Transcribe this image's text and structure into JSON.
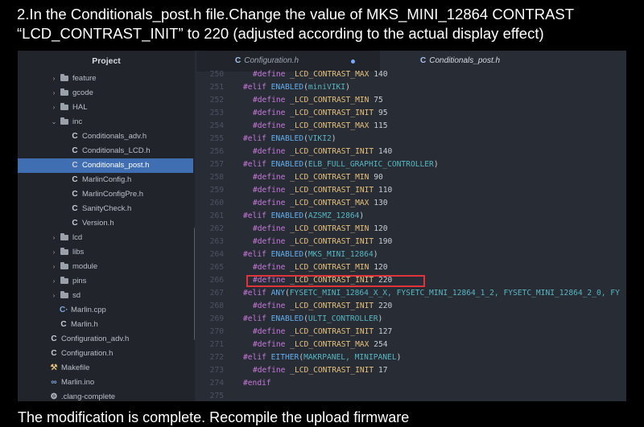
{
  "caption_top": [
    "2.In the Conditionals_post.h file.Change the value of MKS_MINI_12864 CONTRAST",
    "“LCD_CONTRAST_INIT” to 220 (adjusted according to the actual display effect)"
  ],
  "caption_bottom": "The modification is complete. Recompile the upload firmware",
  "sidebar": {
    "title": "Project",
    "items": [
      {
        "label": "feature",
        "type": "folder",
        "expanded": false
      },
      {
        "label": "gcode",
        "type": "folder",
        "expanded": false
      },
      {
        "label": "HAL",
        "type": "folder",
        "expanded": false
      },
      {
        "label": "inc",
        "type": "folder",
        "expanded": true
      },
      {
        "label": "Conditionals_adv.h",
        "type": "c-file"
      },
      {
        "label": "Conditionals_LCD.h",
        "type": "c-file"
      },
      {
        "label": "Conditionals_post.h",
        "type": "c-file",
        "selected": true
      },
      {
        "label": "MarlinConfig.h",
        "type": "c-file"
      },
      {
        "label": "MarlinConfigPre.h",
        "type": "c-file"
      },
      {
        "label": "SanityCheck.h",
        "type": "c-file"
      },
      {
        "label": "Version.h",
        "type": "c-file"
      },
      {
        "label": "lcd",
        "type": "folder",
        "expanded": false
      },
      {
        "label": "libs",
        "type": "folder",
        "expanded": false
      },
      {
        "label": "module",
        "type": "folder",
        "expanded": false
      },
      {
        "label": "pins",
        "type": "folder",
        "expanded": false
      },
      {
        "label": "sd",
        "type": "folder",
        "expanded": false
      },
      {
        "label": "Marlin.cpp",
        "type": "cpp-file"
      },
      {
        "label": "Marlin.h",
        "type": "c-file"
      },
      {
        "label": "Configuration_adv.h",
        "type": "c-file"
      },
      {
        "label": "Configuration.h",
        "type": "c-file"
      },
      {
        "label": "Makefile",
        "type": "make-file"
      },
      {
        "label": "Marlin.ino",
        "type": "ino-file"
      },
      {
        "label": ".clang-complete",
        "type": "gear-file"
      }
    ]
  },
  "tabs": [
    {
      "label": "Configuration.h",
      "modified": true
    },
    {
      "label": "Conditionals_post.h",
      "active": true
    }
  ],
  "code_lines": [
    {
      "n": "250",
      "indent": 1,
      "kind": "define",
      "name": "_LCD_CONTRAST_MAX",
      "value": "140"
    },
    {
      "n": "251",
      "indent": 0,
      "kind": "elif",
      "fn": "ENABLED",
      "arg": "miniVIKI"
    },
    {
      "n": "252",
      "indent": 1,
      "kind": "define",
      "name": "_LCD_CONTRAST_MIN",
      "value": "75"
    },
    {
      "n": "253",
      "indent": 1,
      "kind": "define",
      "name": "_LCD_CONTRAST_INIT",
      "value": "95"
    },
    {
      "n": "254",
      "indent": 1,
      "kind": "define",
      "name": "_LCD_CONTRAST_MAX",
      "value": "115"
    },
    {
      "n": "255",
      "indent": 0,
      "kind": "elif",
      "fn": "ENABLED",
      "arg": "VIKI2"
    },
    {
      "n": "256",
      "indent": 1,
      "kind": "define",
      "name": "_LCD_CONTRAST_INIT",
      "value": "140"
    },
    {
      "n": "257",
      "indent": 0,
      "kind": "elif",
      "fn": "ENABLED",
      "arg": "ELB_FULL_GRAPHIC_CONTROLLER"
    },
    {
      "n": "258",
      "indent": 1,
      "kind": "define",
      "name": "_LCD_CONTRAST_MIN",
      "value": "90"
    },
    {
      "n": "259",
      "indent": 1,
      "kind": "define",
      "name": "_LCD_CONTRAST_INIT",
      "value": "110"
    },
    {
      "n": "260",
      "indent": 1,
      "kind": "define",
      "name": "_LCD_CONTRAST_MAX",
      "value": "130"
    },
    {
      "n": "261",
      "indent": 0,
      "kind": "elif",
      "fn": "ENABLED",
      "arg": "AZSMZ_12864"
    },
    {
      "n": "262",
      "indent": 1,
      "kind": "define",
      "name": "_LCD_CONTRAST_MIN",
      "value": "120"
    },
    {
      "n": "263",
      "indent": 1,
      "kind": "define",
      "name": "_LCD_CONTRAST_INIT",
      "value": "190"
    },
    {
      "n": "264",
      "indent": 0,
      "kind": "elif",
      "fn": "ENABLED",
      "arg": "MKS_MINI_12864"
    },
    {
      "n": "265",
      "indent": 1,
      "kind": "define",
      "name": "_LCD_CONTRAST_MIN",
      "value": "120"
    },
    {
      "n": "266",
      "indent": 1,
      "kind": "define",
      "name": "_LCD_CONTRAST_INIT",
      "value": "220",
      "highlight": true
    },
    {
      "n": "267",
      "indent": 0,
      "kind": "elif",
      "fn": "ANY",
      "arg": "FYSETC_MINI_12864_X_X, FYSETC_MINI_12864_1_2, FYSETC_MINI_12864_2_0, FY"
    },
    {
      "n": "268",
      "indent": 1,
      "kind": "define",
      "name": "_LCD_CONTRAST_INIT",
      "value": "220"
    },
    {
      "n": "269",
      "indent": 0,
      "kind": "elif",
      "fn": "ENABLED",
      "arg": "ULTI_CONTROLLER"
    },
    {
      "n": "270",
      "indent": 1,
      "kind": "define",
      "name": "_LCD_CONTRAST_INIT",
      "value": "127"
    },
    {
      "n": "271",
      "indent": 1,
      "kind": "define",
      "name": "_LCD_CONTRAST_MAX",
      "value": "254"
    },
    {
      "n": "272",
      "indent": 0,
      "kind": "elif",
      "fn": "EITHER",
      "arg": "MAKRPANEL, MINIPANEL"
    },
    {
      "n": "273",
      "indent": 1,
      "kind": "define",
      "name": "_LCD_CONTRAST_INIT",
      "value": "17"
    },
    {
      "n": "274",
      "indent": 0,
      "kind": "endif"
    },
    {
      "n": "275",
      "indent": 0,
      "kind": "blank"
    }
  ],
  "colors": {
    "highlight_box": "#e0343a",
    "selected_item": "#3f6fb2",
    "editor_bg": "#282c34",
    "sidebar_bg": "#21252b"
  }
}
